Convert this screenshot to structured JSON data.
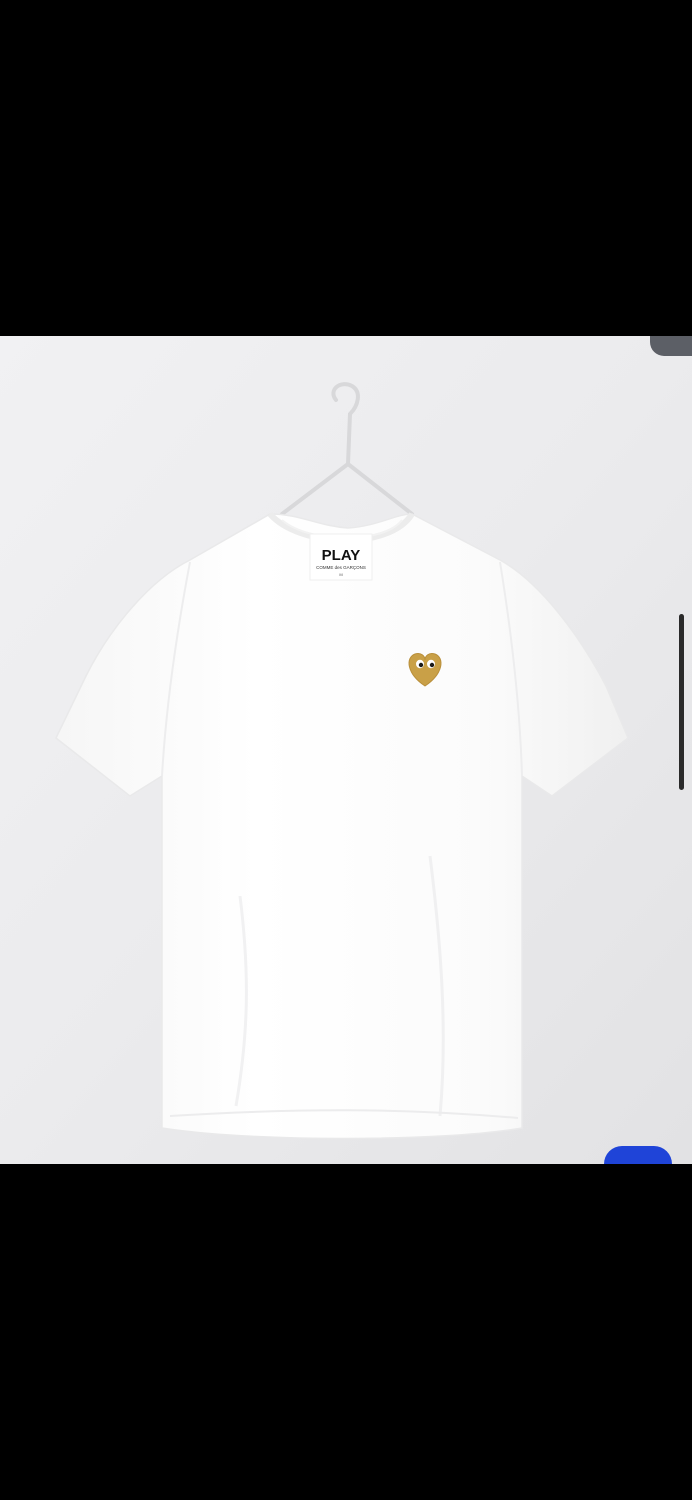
{
  "image": {
    "subject": "white-tshirt-on-hanger",
    "label_text": "PLAY",
    "label_subtext": "COMME des GARÇONS",
    "label_size": "M",
    "emblem": "gold-heart-with-eyes-icon"
  },
  "colors": {
    "background_black": "#000000",
    "photo_background": "#ECECEE",
    "shirt": "#FDFDFD",
    "heart_gold": "#C9A047",
    "fab_blue": "#1F44D8",
    "handle_gray": "#5C5F66"
  },
  "overlays": {
    "top_right_handle": "drag-handle",
    "scroll_indicator": "scrollbar",
    "fab": "action-button"
  }
}
